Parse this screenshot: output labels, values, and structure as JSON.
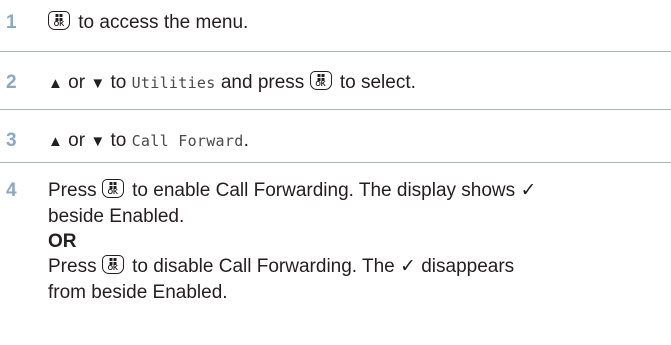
{
  "accent_color": "#8aa9c1",
  "text_color": "#231f20",
  "rule_color": "#aab6bd",
  "icons": {
    "ok_key": "ok-menu-key-icon",
    "up": "up-arrow-icon",
    "down": "down-arrow-icon",
    "check": "check-mark-icon"
  },
  "ok_key_label": "OK",
  "steps": [
    {
      "number": "1",
      "text_a": " to access the menu."
    },
    {
      "number": "2",
      "or": " or ",
      "to": " to ",
      "menu_item": "Utilities",
      "text_b": " and press ",
      "text_c": " to select."
    },
    {
      "number": "3",
      "or": " or ",
      "to": " to ",
      "menu_item": "Call Forward",
      "period": "."
    },
    {
      "number": "4",
      "press": "Press ",
      "enable_text": " to enable Call Forwarding. The display shows ",
      "check": "✓",
      "enable_text_2": "beside Enabled.",
      "or_label": "OR",
      "disable_text": " to disable Call Forwarding. The ",
      "disable_text_2": " disappears",
      "disable_text_3": "from beside Enabled."
    }
  ]
}
